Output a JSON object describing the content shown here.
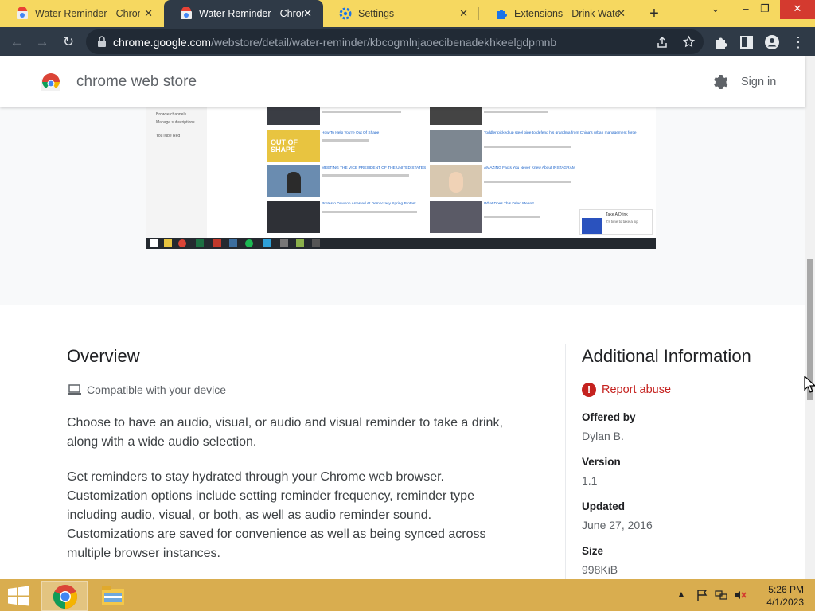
{
  "browser": {
    "tabs": [
      {
        "title": "Water Reminder - Chrome",
        "active": false
      },
      {
        "title": "Water Reminder - Chrome",
        "active": true
      },
      {
        "title": "Settings",
        "active": false
      },
      {
        "title": "Extensions - Drink Water",
        "active": false
      }
    ],
    "new_tab_label": "+",
    "url_host": "chrome.google.com",
    "url_path": "/webstore/detail/water-reminder/kbcogmlnjaoecibenadekhkeelgdpmnb"
  },
  "store": {
    "title": "chrome web store",
    "sign_in": "Sign in"
  },
  "gallery": {
    "sidebar_items": [
      "Browse channels",
      "Manage subscriptions",
      "YouTube Red"
    ],
    "video_titles": [
      "How To Help You're Out Of Shape",
      "MEETING THE VICE PRESIDENT OF THE UNITED STATES",
      "Protesto Dawson Arrested At Democracy Spring Protest",
      "Toddler picked up steel pipe to defend his grandma from China's urban management force",
      "AMAZING Facts You Never Knew About INSTAGRAM",
      "What Does This Dried Mean?"
    ],
    "popup_text": "Take A Drink",
    "popup_sub": "It's time to take a sip"
  },
  "overview": {
    "heading": "Overview",
    "compat": "Compatible with your device",
    "para1": "Choose to have an audio, visual, or audio and visual reminder to take a drink, along with a wide audio selection.",
    "para2": "Get reminders to stay hydrated through your Chrome web browser. Customization options include setting reminder frequency, reminder type including audio, visual, or both, as well as audio reminder sound. Customizations are saved for convenience as well as being synced across multiple browser instances."
  },
  "info": {
    "heading": "Additional Information",
    "report": "Report abuse",
    "offered_by_label": "Offered by",
    "offered_by": "Dylan B.",
    "version_label": "Version",
    "version": "1.1",
    "updated_label": "Updated",
    "updated": "June 27, 2016",
    "size_label": "Size",
    "size": "998KiB"
  },
  "taskbar": {
    "time": "5:26 PM",
    "date": "4/1/2023"
  },
  "colors": {
    "tabstrip": "#f6d860",
    "toolbar": "#2f3a47",
    "taskbar": "#d9ad4f",
    "report": "#c5221f"
  }
}
